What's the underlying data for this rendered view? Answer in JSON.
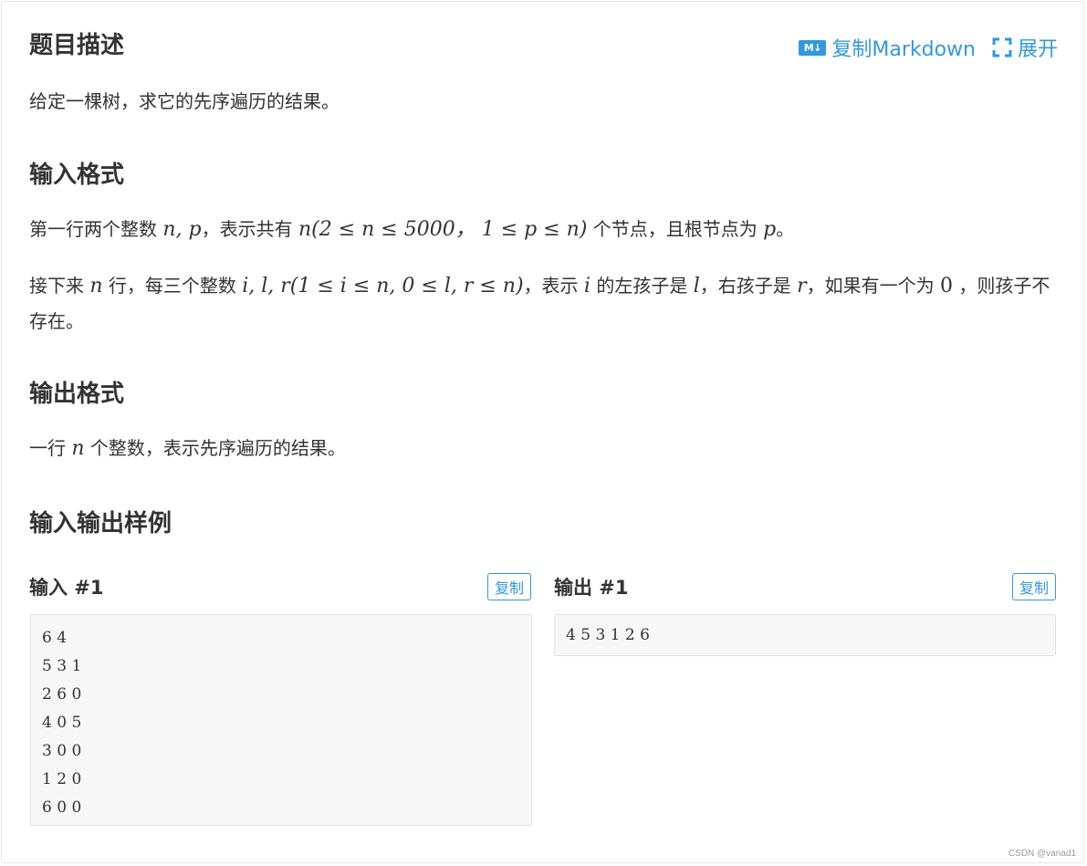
{
  "toolbar": {
    "md_icon_text": "M↓",
    "copy_markdown": "复制Markdown",
    "expand": "展开",
    "accent": "#3498db"
  },
  "sections": {
    "description": {
      "title": "题目描述",
      "text": "给定一棵树，求它的先序遍历的结果。"
    },
    "input_format": {
      "title": "输入格式",
      "line1": {
        "a": "第一行两个整数 ",
        "m1": "n, p",
        "b": "，表示共有 ",
        "m2": "n(2 ≤ n ≤ 5000， 1 ≤ p ≤ n)",
        "c": " 个节点，且根节点为 ",
        "m3": "p",
        "d": "。"
      },
      "line2": {
        "a": "接下来 ",
        "m1": "n",
        "b": " 行，每三个整数 ",
        "m2": "i, l, r(1 ≤ i ≤ n, 0 ≤ l, r ≤ n)",
        "c": "，表示 ",
        "m3": "i",
        "d": " 的左孩子是 ",
        "m4": "l",
        "e": "，右孩子是 ",
        "m5": "r",
        "f": "，如果有一个为 ",
        "m6": "0",
        "g": " ，则孩子不存在。"
      }
    },
    "output_format": {
      "title": "输出格式",
      "a": "一行 ",
      "m1": "n",
      "b": " 个整数，表示先序遍历的结果。"
    },
    "samples": {
      "title": "输入输出样例",
      "input_label": "输入 #1",
      "output_label": "输出 #1",
      "copy_label": "复制",
      "input_text": "6 4\n5 3 1\n2 6 0\n4 0 5\n3 0 0\n1 2 0\n6 0 0",
      "output_text": "4 5 3 1 2 6"
    }
  },
  "watermark": "CSDN @vanad1"
}
